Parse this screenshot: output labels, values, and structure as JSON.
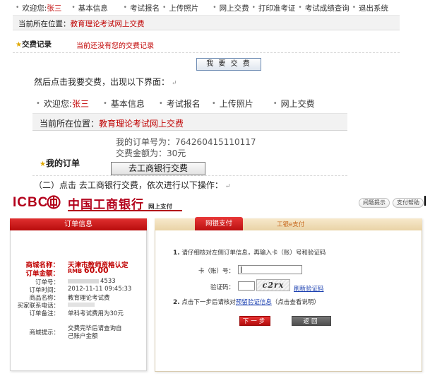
{
  "screen1": {
    "nav": {
      "welcome": "欢迎您:",
      "user": "张三",
      "items": [
        "基本信息",
        "考试报名",
        "上传照片",
        "网上交费",
        "打印准考证",
        "考试成绩查询",
        "退出系统"
      ]
    },
    "location_label": "当前所在位置：",
    "location_value": "教育理论考试网上交费",
    "records_title": "交费记录",
    "records_msg": "当前还没有您的交费记录",
    "pay_button": "我 要 交 费"
  },
  "paragraph1": "然后点击我要交费，出现以下界面：",
  "screen2": {
    "nav": {
      "welcome": "欢迎您:",
      "user": "张三",
      "items": [
        "基本信息",
        "考试报名",
        "上传照片",
        "网上交费"
      ]
    },
    "location_label": "当前所在位置：",
    "location_value": "教育理论考试网上交费",
    "order_no_label": "我的订单号为：",
    "order_no": "764260415110117",
    "amount_label": "交费金额为：",
    "amount": "30元",
    "my_order": "我的订单",
    "go_button": "去工商银行交费"
  },
  "paragraph2": "（二）点击 去工商银行交费，依次进行以下操作：",
  "icbc": {
    "logo": "ICBC",
    "bank_name": "中国工商银行",
    "online_pay": "网上支付",
    "help_btn": "间题提示",
    "help2_btn": "支付帮助",
    "order_panel_title": "订单信息",
    "order": {
      "merchant_label": "商城名称：",
      "merchant": "天津市教师资格认定",
      "amount_label": "订单金额：",
      "currency": "RMB",
      "amount": "60.00",
      "order_no_label": "订单号：",
      "order_no_tail": "4533",
      "time_label": "订单时间：",
      "time": "2012-11-11 09:45:33",
      "goods_label": "商品名称：",
      "goods": "教育理论考试费",
      "buyer_label": "买家联系电话：",
      "remark_label": "订单备注：",
      "remark": "单科考试费用为30元",
      "tip_label": "商城提示：",
      "tip": "交费完毕后请查询自己账户金额"
    },
    "tab_active": "网银支付",
    "tab_other": "工银e支付",
    "step1": "请仔细核对左侧订单信息，再输入卡（账）号和验证码",
    "card_label": "卡（账）号：",
    "code_label": "验证码：",
    "captcha": "c2rx",
    "refresh": "刷新验证码",
    "step2_pre": "点击下一步后请核对",
    "step2_link": "预留验证信息",
    "step2_post": "（点击查看说明）",
    "next_btn": "下一步",
    "back_btn": "返回"
  },
  "colors": {
    "brand_red": "#b3001b",
    "accent_red": "#c00000",
    "link_blue": "#1a3fb0"
  }
}
